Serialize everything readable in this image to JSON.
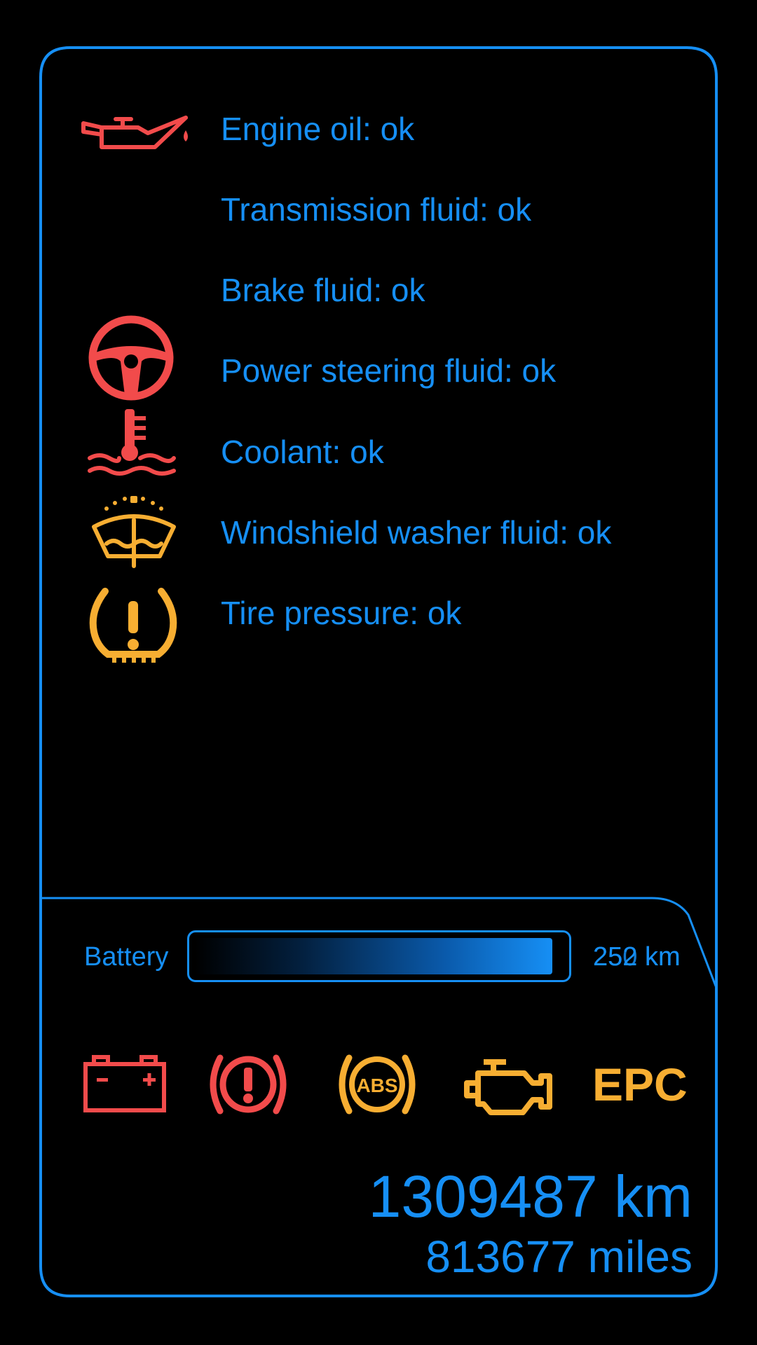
{
  "theme": {
    "text": "#168ff5",
    "frame": "#168ff5",
    "warning_red": "#f24b4b",
    "warning_amber": "#f7ae32"
  },
  "fluids": [
    {
      "label": "Engine oil: ok",
      "icon": "oil-can-icon",
      "icon_color": "#f24b4b"
    },
    {
      "label": "Transmission fluid: ok",
      "icon": "none"
    },
    {
      "label": "Brake fluid: ok",
      "icon": "none"
    },
    {
      "label": "Power steering fluid: ok",
      "icon": "steering-wheel-icon",
      "icon_color": "#f24b4b"
    },
    {
      "label": "Coolant: ok",
      "icon": "coolant-temperature-icon",
      "icon_color": "#f24b4b"
    },
    {
      "label": "Windshield washer fluid: ok",
      "icon": "washer-fluid-icon",
      "icon_color": "#f7ae32"
    },
    {
      "label": "Tire pressure: ok",
      "icon": "tire-pressure-icon",
      "icon_color": "#f7ae32"
    }
  ],
  "battery": {
    "label": "Battery",
    "level_fraction": 0.97,
    "range_overlapping_texts": [
      "252 km",
      "250 km"
    ]
  },
  "warning_lights": [
    {
      "icon": "battery-icon",
      "color": "#f24b4b"
    },
    {
      "icon": "brake-warning-icon",
      "color": "#f24b4b"
    },
    {
      "icon": "abs-icon",
      "color": "#f7ae32",
      "text": "ABS"
    },
    {
      "icon": "check-engine-icon",
      "color": "#f7ae32"
    },
    {
      "icon": "epc-icon",
      "color": "#f7ae32",
      "text": "EPC"
    }
  ],
  "odometer": {
    "km": "1309487 km",
    "miles": "813677 miles"
  }
}
